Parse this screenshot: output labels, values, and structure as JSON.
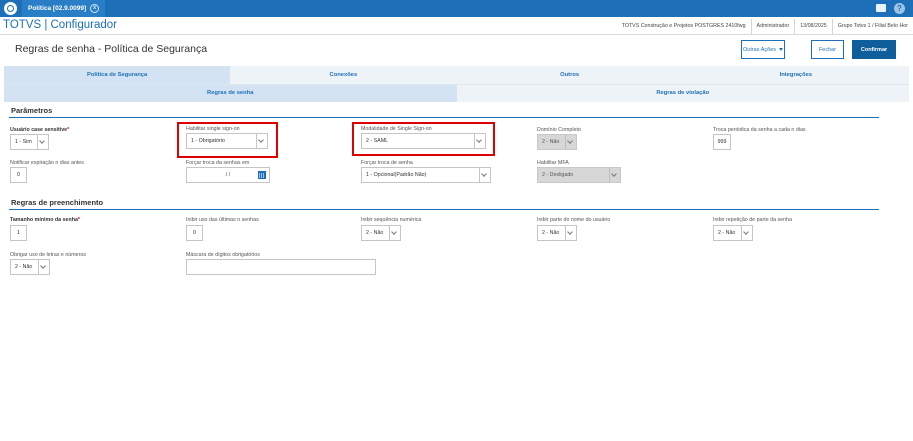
{
  "window": {
    "tab_title": "Política [02.9.0099]",
    "close_glyph": "x"
  },
  "header": {
    "brand": "TOTVS | Configurador",
    "company": "TOTVS Construção e Projetos POSTGRES 2410fwg",
    "user": "Administrador",
    "date": "13/08/2025",
    "branch": "Grupo Totvs 1 / Filial Belo Hor"
  },
  "page": {
    "title": "Regras de senha - Política de Segurança",
    "buttons": {
      "outras_acoes": "Outras Ações",
      "fechar": "Fechar",
      "confirmar": "Confirmar"
    }
  },
  "tabs": [
    "Política de Segurança",
    "Conexões",
    "Outros",
    "Integrações"
  ],
  "subtabs": [
    "Regras de senha",
    "Regras de violação"
  ],
  "parametros": {
    "title": "Parâmetros",
    "usuario_case": {
      "label": "Usuário case sensitive",
      "value": "1 - Sim"
    },
    "sso": {
      "label": "Habilitar single sign-on",
      "value": "1 - Obrigatório"
    },
    "modalidade": {
      "label": "Modalidade de Single Sign-on",
      "value": "2 - SAML"
    },
    "dominio": {
      "label": "Domínio Completo",
      "value": "2 - Não"
    },
    "troca_periodica": {
      "label": "Troca periódica da senha a cada n dias",
      "value": "999"
    },
    "notificar": {
      "label": "Notificar expiração n dias antes",
      "value": "0"
    },
    "forcar_troca_em": {
      "label": "Forçar troca da senhas em",
      "value": "/ /"
    },
    "forcar_troca": {
      "label": "Forçar troca de senha",
      "value": "1 - Opcional(Padrão Não)"
    },
    "mfa": {
      "label": "Habilitar MFA",
      "value": "2 - Desligado"
    }
  },
  "preenchimento": {
    "title": "Regras de preenchimento",
    "tamanho": {
      "label": "Tamanho mínimo da senha",
      "value": "1"
    },
    "ultimas": {
      "label": "Inibir uso das últimas n senhas",
      "value": "0"
    },
    "sequencia": {
      "label": "Inibir sequência numérica",
      "value": "2 - Não"
    },
    "nome_usuario": {
      "label": "Inibir parte do nome do usuário",
      "value": "2 - Não"
    },
    "repeticao": {
      "label": "Inibir repetição de parte da senha",
      "value": "2 - Não"
    },
    "letras_numeros": {
      "label": "Obrigar uso de letras e números",
      "value": "2 - Não"
    },
    "mascara": {
      "label": "Máscara de dígitos obrigatórios",
      "value": ""
    }
  },
  "required_mark": "*",
  "colors": {
    "accent": "#1d70b7",
    "highlight": "#e00000"
  }
}
